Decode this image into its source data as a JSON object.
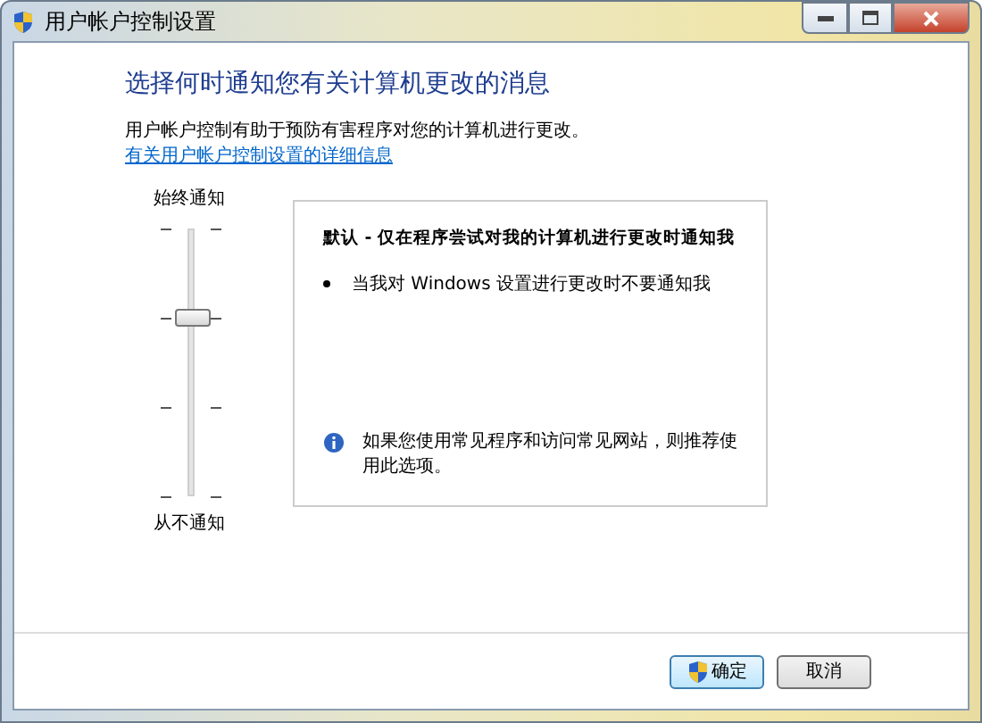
{
  "window": {
    "title": "用户帐户控制设置"
  },
  "heading": "选择何时通知您有关计算机更改的消息",
  "description": "用户帐户控制有助于预防有害程序对您的计算机进行更改。",
  "link": "有关用户帐户控制设置的详细信息",
  "slider": {
    "top_label": "始终通知",
    "bottom_label": "从不通知",
    "level": 0.6667
  },
  "info_box": {
    "title": "默认 - 仅在程序尝试对我的计算机进行更改时通知我",
    "bullets": [
      "当我对 Windows 设置进行更改时不要通知我"
    ],
    "note": "如果您使用常见程序和访问常见网站，则推荐使用此选项。"
  },
  "buttons": [
    {
      "label": "确定",
      "kind": "shield",
      "default": true
    },
    {
      "label": "取消",
      "kind": "plain",
      "default": false
    }
  ]
}
